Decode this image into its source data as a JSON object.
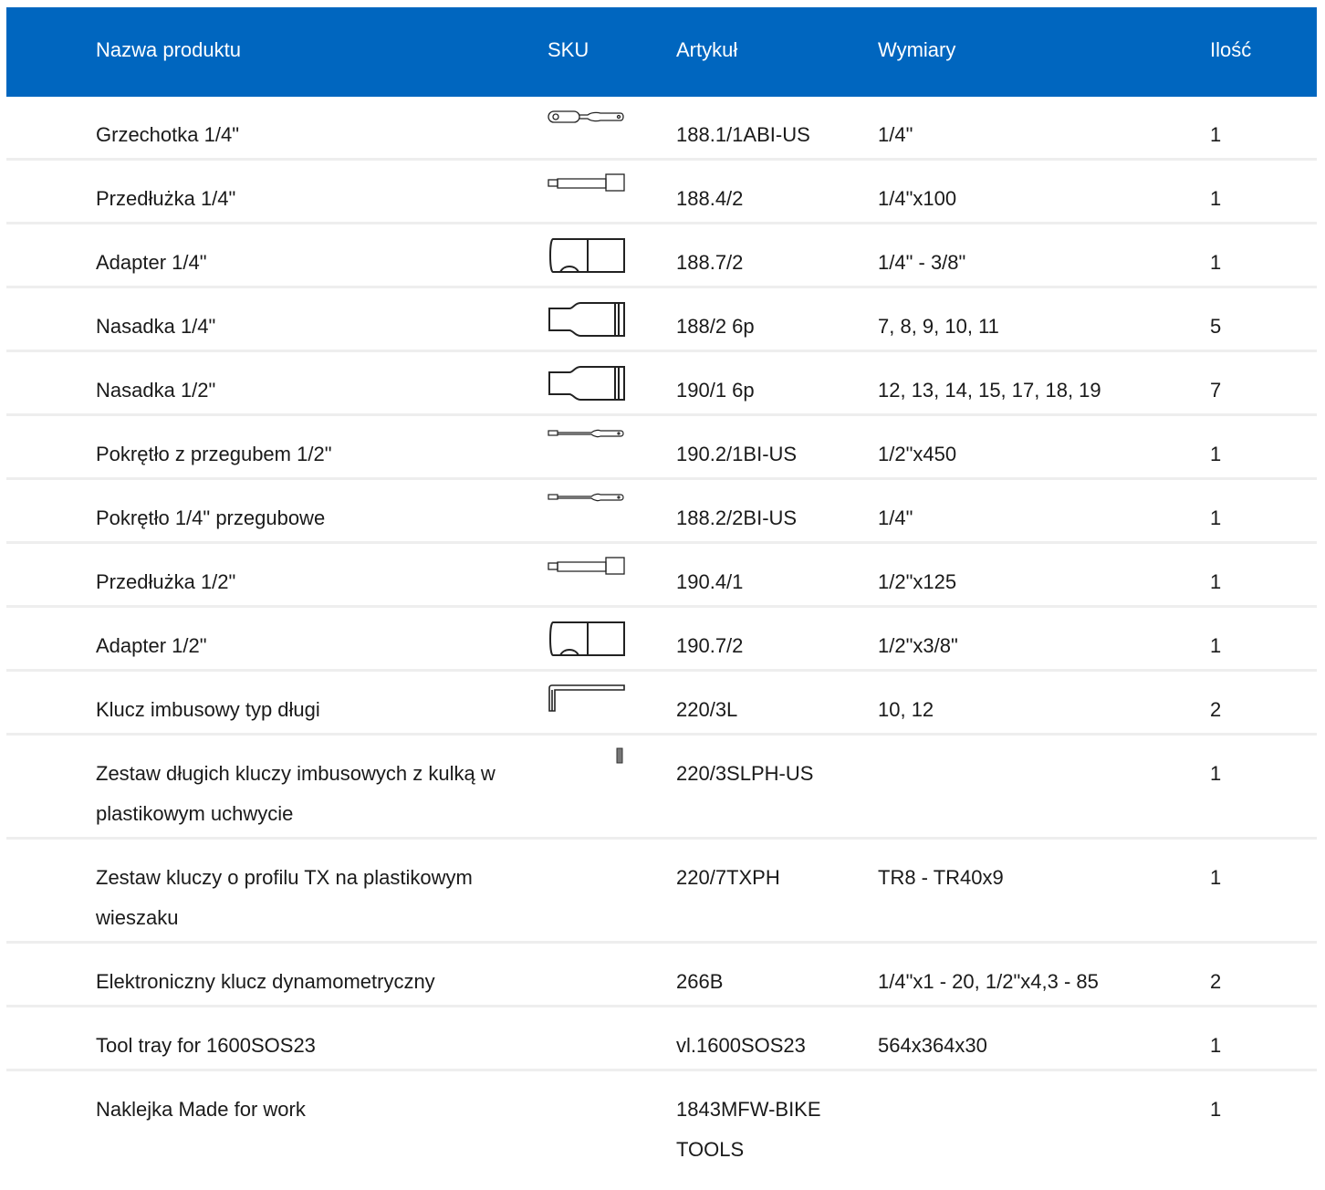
{
  "colors": {
    "header_bg": "#0066bf",
    "header_text": "#ffffff",
    "row_divider": "#eeeeee"
  },
  "header": {
    "name": "Nazwa produktu",
    "sku": "SKU",
    "article": "Artykuł",
    "dimensions": "Wymiary",
    "quantity": "Ilość"
  },
  "rows": [
    {
      "name": "Grzechotka 1/4\"",
      "icon": "ratchet-icon",
      "article": "188.1/1ABI-US",
      "dimensions": "1/4\"",
      "quantity": "1"
    },
    {
      "name": "Przedłużka 1/4\"",
      "icon": "extension-bar-icon",
      "article": "188.4/2",
      "dimensions": "1/4\"x100",
      "quantity": "1"
    },
    {
      "name": "Adapter 1/4\"",
      "icon": "adapter-icon",
      "article": "188.7/2",
      "dimensions": "1/4\" - 3/8\"",
      "quantity": "1"
    },
    {
      "name": "Nasadka 1/4\"",
      "icon": "socket-icon",
      "article": "188/2 6p",
      "dimensions": "7, 8, 9, 10, 11",
      "quantity": "5"
    },
    {
      "name": "Nasadka 1/2\"",
      "icon": "socket-icon",
      "article": "190/1 6p",
      "dimensions": "12, 13, 14, 15, 17, 18, 19",
      "quantity": "7"
    },
    {
      "name": "Pokrętło z przegubem 1/2\"",
      "icon": "breaker-bar-icon",
      "article": "190.2/1BI-US",
      "dimensions": "1/2\"x450",
      "quantity": "1"
    },
    {
      "name": "Pokrętło 1/4\" przegubowe",
      "icon": "breaker-bar-icon",
      "article": "188.2/2BI-US",
      "dimensions": "1/4\"",
      "quantity": "1"
    },
    {
      "name": "Przedłużka 1/2\"",
      "icon": "extension-bar-icon",
      "article": "190.4/1",
      "dimensions": "1/2\"x125",
      "quantity": "1"
    },
    {
      "name": "Adapter 1/2\"",
      "icon": "adapter-icon",
      "article": "190.7/2",
      "dimensions": "1/2\"x3/8\"",
      "quantity": "1"
    },
    {
      "name": "Klucz imbusowy typ długi",
      "icon": "hex-key-icon",
      "article": "220/3L",
      "dimensions": "10, 12",
      "quantity": "2"
    },
    {
      "name": "Zestaw długich kluczy imbusowych z kulką w plastikowym uchwycie",
      "icon": "hex-key-set-icon",
      "article": "220/3SLPH-US",
      "dimensions": "",
      "quantity": "1"
    },
    {
      "name": "Zestaw kluczy o profilu TX na plastikowym wieszaku",
      "icon": "",
      "article": "220/7TXPH",
      "dimensions": "TR8 - TR40x9",
      "quantity": "1"
    },
    {
      "name": "Elektroniczny klucz dynamometryczny",
      "icon": "",
      "article": "266B",
      "dimensions": "1/4\"x1 - 20, 1/2\"x4,3 - 85",
      "quantity": "2"
    },
    {
      "name": "Tool tray for 1600SOS23",
      "icon": "",
      "article": "vl.1600SOS23",
      "dimensions": "564x364x30",
      "quantity": "1"
    },
    {
      "name": "Naklejka Made for work",
      "icon": "",
      "article": "1843MFW-BIKE TOOLS",
      "dimensions": "",
      "quantity": "1"
    }
  ]
}
